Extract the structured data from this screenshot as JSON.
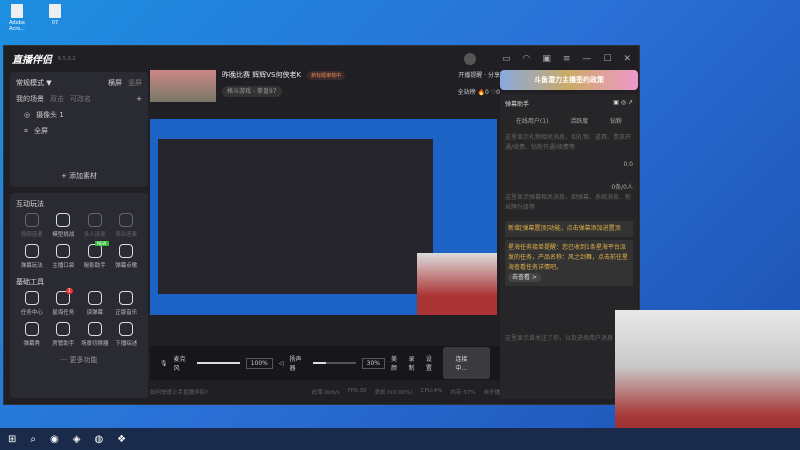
{
  "desktop": {
    "icons": [
      "Adobe Acro...",
      "07"
    ]
  },
  "app": {
    "name": "直播伴侣",
    "version": "6.5.3.2"
  },
  "left": {
    "mode": "常规模式 ▼",
    "landscape": "横屏",
    "portrait": "竖屏",
    "scene_label": "我的场景",
    "dbl": "双击",
    "rename": "可改名",
    "sources": [
      "摄像头 1",
      "全屏"
    ],
    "add_material": "+ 添加素材",
    "interactive_title": "互动玩法",
    "interactive": [
      {
        "label": "视频连麦",
        "dim": true
      },
      {
        "label": "模型挑战"
      },
      {
        "label": "多人连麦",
        "dim": true
      },
      {
        "label": "观众连麦",
        "dim": true
      },
      {
        "label": "弹幕玩法"
      },
      {
        "label": "主播口袋"
      },
      {
        "label": "秘影助手",
        "new": "NEW"
      },
      {
        "label": "弹幕点歌"
      }
    ],
    "basic_title": "基础工具",
    "basic": [
      {
        "label": "任务中心"
      },
      {
        "label": "星海任务",
        "badge": "1"
      },
      {
        "label": "读弹幕"
      },
      {
        "label": "正版音乐"
      },
      {
        "label": "弹幕秀"
      },
      {
        "label": "房管助手"
      },
      {
        "label": "场景切换器"
      },
      {
        "label": "下播综述"
      }
    ],
    "more": "··· 更多功能"
  },
  "stream": {
    "title": "昨晚比赛 辉辉VS何侠老K",
    "tag": "新标题审核中",
    "category": "格斗游戏 - 拳皇97",
    "remind": "开播提醒",
    "share": "分享",
    "rank": "全站榜",
    "likes": "0",
    "hearts": "0"
  },
  "controls": {
    "mic": "麦克风",
    "mic_vol": "100%",
    "speaker": "扬声器",
    "speaker_vol": "30%",
    "beauty": "美颜",
    "record": "录制",
    "settings": "设置",
    "live": "连接中..."
  },
  "status": {
    "help": "如何快速上手直播伴侣?",
    "rate": "码率:0kb/s",
    "fps": "FPS:30",
    "drop": "丢帧:0(0.00%)",
    "cpu": "CPU:4%",
    "mem": "内存:37%",
    "state": "未开播"
  },
  "right": {
    "banner": "斗鱼潜力主播签约政策",
    "title": "弹幕助手",
    "tabs": [
      "在线用户(1)",
      "活跃度",
      "钻粉"
    ],
    "gift_msg": "这里显示礼物相关消息，如礼物、道具、贵族开通/续费、钻粉开通/续费等",
    "gift_val": "0.0",
    "danmu_count": "0条/0人",
    "danmu_msg": "这里显示弹幕相关消息，如弹幕、系统消息、粉丝牌升级等",
    "notice1": "新增[弹幕置顶]功能，点击弹幕添加进置顶",
    "notice2": "星海任务接单提醒：您已收到1条星海平台派发的任务，产品名称：风之剑舞，点击前往星海查看任务详情吧。",
    "go": "去查看 >",
    "follow_msg": "这里显示谁关注了你，以及进场用户消息"
  }
}
